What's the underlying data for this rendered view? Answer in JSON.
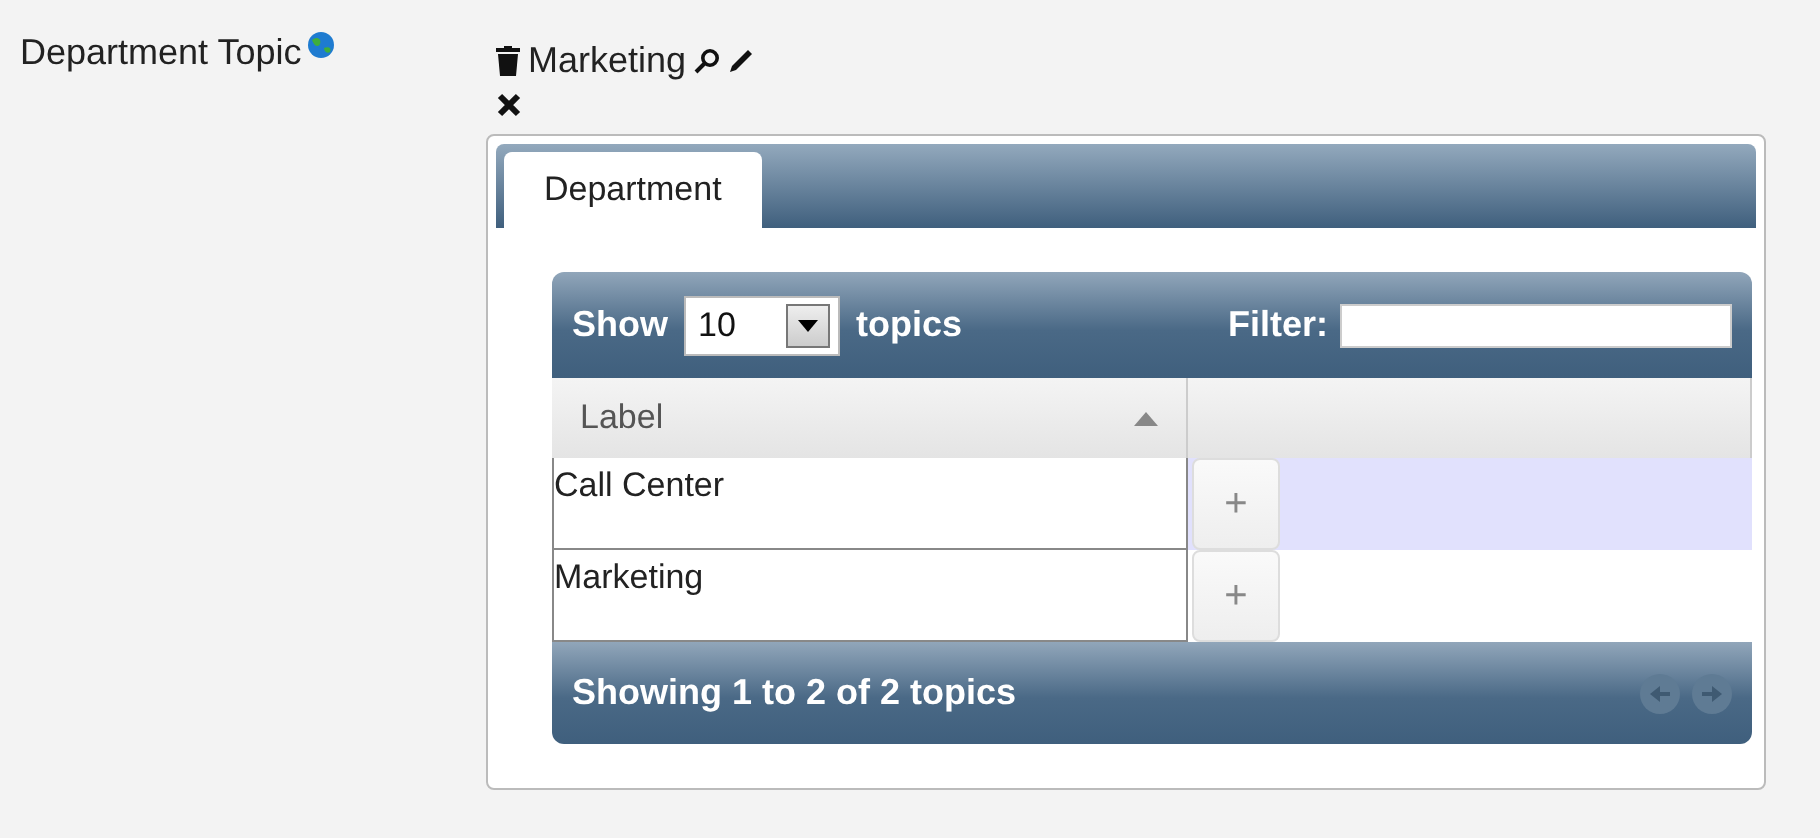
{
  "field": {
    "label": "Department Topic",
    "value": "Marketing"
  },
  "tabs": [
    {
      "label": "Department",
      "selected": true
    }
  ],
  "toolbar": {
    "show_label": "Show",
    "page_size": "10",
    "topics_label": "topics",
    "filter_label": "Filter:"
  },
  "table": {
    "columns": [
      {
        "label": "Label",
        "sorted": true
      },
      {
        "sorted": false
      }
    ],
    "rows": [
      {
        "label": "Call Center",
        "action": "+",
        "selected": true
      },
      {
        "label": "Marketing",
        "action": "+",
        "selected": false
      }
    ]
  },
  "footer": {
    "info": "Showing 1 to 2 of 2 topics",
    "prev_disabled": true,
    "next_disabled": true
  }
}
